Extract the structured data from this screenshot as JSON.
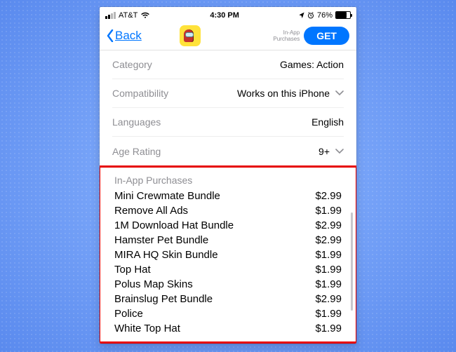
{
  "status": {
    "carrier": "AT&T",
    "time": "4:30 PM",
    "battery_pct": "76%"
  },
  "nav": {
    "back_label": "Back",
    "iap_hint_l1": "In-App",
    "iap_hint_l2": "Purchases",
    "get_label": "GET"
  },
  "info": {
    "category_key": "Category",
    "category_val": "Games: Action",
    "compat_key": "Compatibility",
    "compat_val": "Works on this iPhone",
    "lang_key": "Languages",
    "lang_val": "English",
    "age_key": "Age Rating",
    "age_val": "9+"
  },
  "iap": {
    "title": "In-App Purchases",
    "items": [
      {
        "name": "Mini Crewmate Bundle",
        "price": "$2.99"
      },
      {
        "name": "Remove All Ads",
        "price": "$1.99"
      },
      {
        "name": "1M Download Hat Bundle",
        "price": "$2.99"
      },
      {
        "name": "Hamster Pet Bundle",
        "price": "$2.99"
      },
      {
        "name": "MIRA HQ Skin Bundle",
        "price": "$1.99"
      },
      {
        "name": "Top Hat",
        "price": "$1.99"
      },
      {
        "name": "Polus Map Skins",
        "price": "$1.99"
      },
      {
        "name": "Brainslug Pet Bundle",
        "price": "$2.99"
      },
      {
        "name": "Police",
        "price": "$1.99"
      },
      {
        "name": "White Top Hat",
        "price": "$1.99"
      }
    ]
  }
}
